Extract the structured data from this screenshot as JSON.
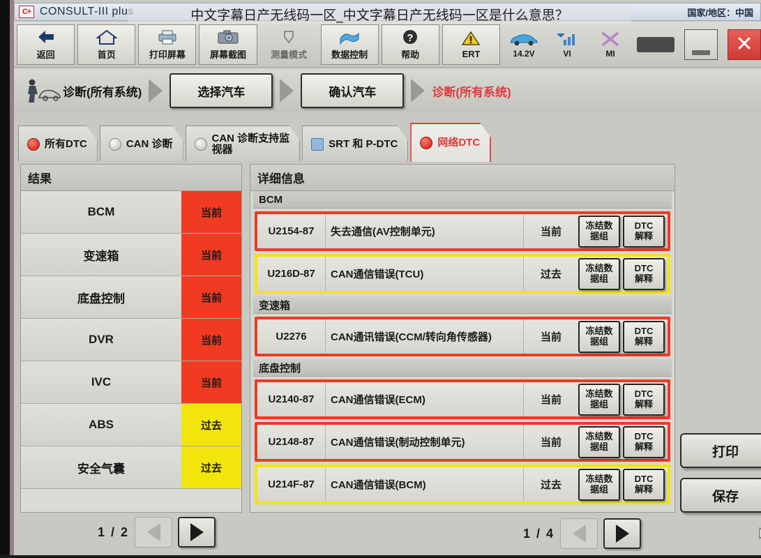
{
  "window": {
    "app_title": "CONSULT-III plus",
    "logo_text": "C+",
    "region_label": "国家/地区：中国",
    "minimize_icon": "minimize-icon",
    "close_icon": "close-icon"
  },
  "overlay": {
    "text": "中文字幕日产无线码一区_中文字幕日产无线码一区是什么意思？"
  },
  "toolbar": {
    "buttons": [
      {
        "label": "返回",
        "icon": "back-arrow-icon",
        "enabled": true
      },
      {
        "label": "首页",
        "icon": "home-icon",
        "enabled": true
      },
      {
        "label": "打印屏幕",
        "icon": "printer-icon",
        "enabled": true
      },
      {
        "label": "屏幕截图",
        "icon": "camera-icon",
        "enabled": true
      },
      {
        "label": "测量模式",
        "icon": "measure-icon",
        "enabled": false
      },
      {
        "label": "数据控制",
        "icon": "data-control-icon",
        "enabled": true
      },
      {
        "label": "帮助",
        "icon": "help-icon",
        "enabled": true
      },
      {
        "label": "ERT",
        "icon": "warning-triangle-icon",
        "enabled": true
      }
    ],
    "status": [
      {
        "label": "14.2V",
        "icon": "car-icon"
      },
      {
        "label": "VI",
        "icon": "signal-icon"
      },
      {
        "label": "MI",
        "icon": "x-mark-icon"
      }
    ]
  },
  "breadcrumb": {
    "icon": "mechanic-car-icon",
    "root": "诊断(所有系统)",
    "steps": [
      "选择汽车",
      "确认汽车"
    ],
    "current": "诊断(所有系统)"
  },
  "tabs": [
    {
      "label": "所有DTC",
      "indicator": "red-led-icon",
      "active": false
    },
    {
      "label": "CAN 诊断",
      "indicator": "grey-led-icon",
      "active": false
    },
    {
      "label": "CAN 诊断支持监\n视器",
      "indicator": "grey-led-icon",
      "active": false
    },
    {
      "label": "SRT 和 P-DTC",
      "indicator": "monitor-icon",
      "active": false
    },
    {
      "label": "网络DTC",
      "indicator": "red-led-icon",
      "active": true
    }
  ],
  "results_panel": {
    "title": "结果",
    "rows": [
      {
        "system": "BCM",
        "status": "当前",
        "state": "cur"
      },
      {
        "system": "变速箱",
        "status": "当前",
        "state": "cur"
      },
      {
        "system": "底盘控制",
        "status": "当前",
        "state": "cur"
      },
      {
        "system": "DVR",
        "status": "当前",
        "state": "cur"
      },
      {
        "system": "IVC",
        "status": "当前",
        "state": "cur"
      },
      {
        "system": "ABS",
        "status": "过去",
        "state": "past"
      },
      {
        "system": "安全气囊",
        "status": "过去",
        "state": "past"
      }
    ],
    "pagination": {
      "text": "1 / 2",
      "prev_icon": "prev-arrow-icon",
      "next_icon": "next-arrow-icon"
    }
  },
  "details_panel": {
    "title": "详细信息",
    "freeze_button_label": "冻结数\n据组",
    "dtc_button_label": "DTC\n解释",
    "groups": [
      {
        "name": "BCM",
        "rows": [
          {
            "code": "U2154-87",
            "description": "失去通信(AV控制单元)",
            "status": "当前",
            "state": "cur"
          },
          {
            "code": "U216D-87",
            "description": "CAN通信错误(TCU)",
            "status": "过去",
            "state": "past"
          }
        ]
      },
      {
        "name": "变速箱",
        "rows": [
          {
            "code": "U2276",
            "description": "CAN通讯错误(CCM/转向角传感器)",
            "status": "当前",
            "state": "cur"
          }
        ]
      },
      {
        "name": "底盘控制",
        "rows": [
          {
            "code": "U2140-87",
            "description": "CAN通信错误(ECM)",
            "status": "当前",
            "state": "cur"
          },
          {
            "code": "U2148-87",
            "description": "CAN通信错误(制动控制单元)",
            "status": "当前",
            "state": "cur"
          },
          {
            "code": "U214F-87",
            "description": "CAN通信错误(BCM)",
            "status": "过去",
            "state": "past"
          }
        ]
      }
    ],
    "pagination": {
      "text": "1 / 4",
      "prev_icon": "prev-arrow-icon",
      "next_icon": "next-arrow-icon"
    }
  },
  "side_actions": [
    {
      "label": "打印"
    },
    {
      "label": "保存"
    }
  ],
  "colors": {
    "status_current": "#f03a22",
    "status_past": "#f2e50c",
    "accent_red": "#e0383c",
    "panel_bg": "#d8d8d3"
  }
}
